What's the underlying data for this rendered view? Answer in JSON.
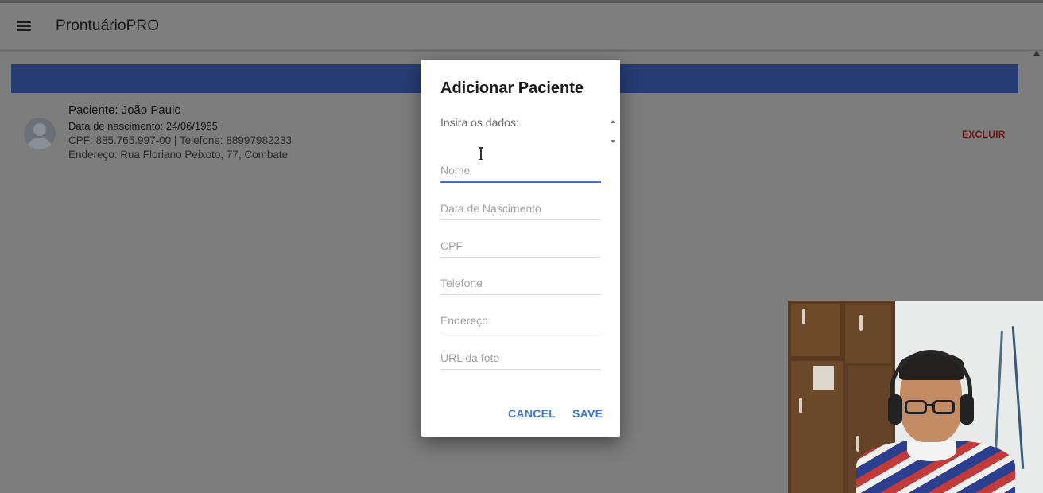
{
  "app": {
    "title": "ProntuárioPRO",
    "menu_icon": "menu-icon"
  },
  "patients": [
    {
      "name_line": "Paciente: João Paulo",
      "birth_line": "Data de nascimento: 24/06/1985",
      "contact_line": "CPF: 885.765.997-00 | Telefone: 88997982233",
      "address_line": "Endereço: Rua Floriano Peixoto, 77, Combate",
      "delete_label": "EXCLUIR"
    }
  ],
  "dialog": {
    "title": "Adicionar Paciente",
    "subtitle": "Insira os dados:",
    "fields": [
      {
        "placeholder": "Nome",
        "value": ""
      },
      {
        "placeholder": "Data de Nascimento",
        "value": ""
      },
      {
        "placeholder": "CPF",
        "value": ""
      },
      {
        "placeholder": "Telefone",
        "value": ""
      },
      {
        "placeholder": "Endereço",
        "value": ""
      },
      {
        "placeholder": "URL da foto",
        "value": ""
      }
    ],
    "cancel_label": "CANCEL",
    "save_label": "SAVE"
  },
  "colors": {
    "overlay_background": "#7d7d7d",
    "header_bar": "#263c73",
    "accent": "#3f76d8",
    "delete": "#7a1414"
  }
}
